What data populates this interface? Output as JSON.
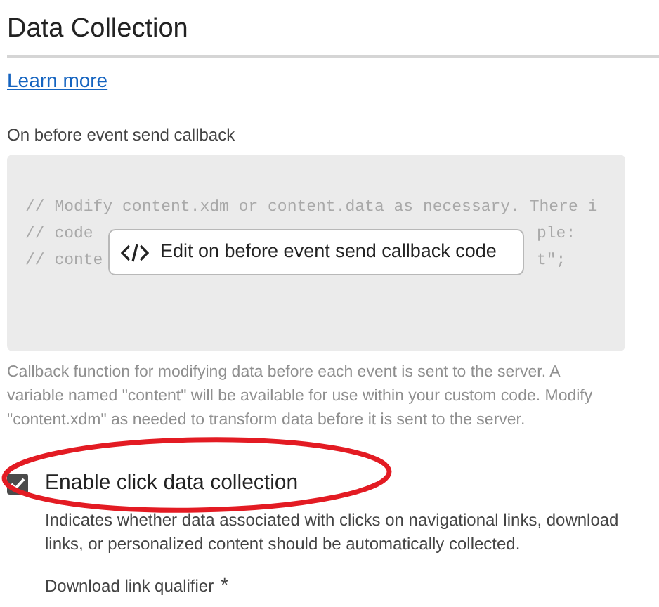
{
  "heading": "Data Collection",
  "learn_more": "Learn more",
  "callback": {
    "label": "On before event send callback",
    "code_lines": [
      {
        "start": "// Modify content.xdm or content.data as necessary. There i"
      },
      {
        "start": "// code",
        "end": "ple:"
      },
      {
        "start": "// conte",
        "end": "t\";"
      }
    ],
    "edit_button": "Edit on before event send callback code",
    "help": "Callback function for modifying data before each event is sent to the server. A variable named \"content\" will be available for use within your custom code. Modify \"content.xdm\" as needed to transform data before it is sent to the server."
  },
  "click_collection": {
    "label": "Enable click data collection",
    "checked": true,
    "help": "Indicates whether data associated with clicks on navigational links, download links, or personalized content should be automatically collected."
  },
  "download_qualifier": {
    "label": "Download link qualifier",
    "required_mark": "*"
  }
}
